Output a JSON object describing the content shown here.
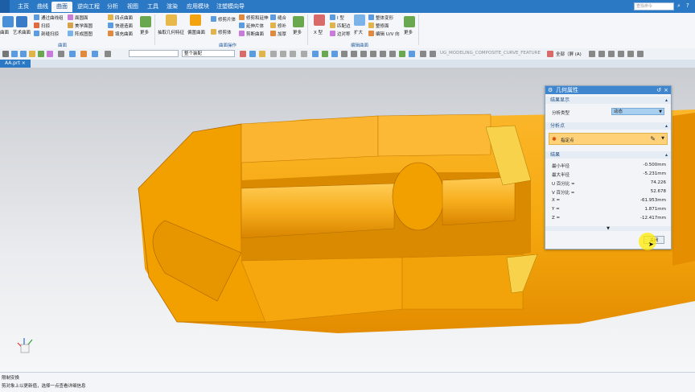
{
  "menubar": {
    "tabs": [
      "主页",
      "曲线",
      "曲面",
      "逆向工程",
      "分析",
      "视图",
      "工具",
      "渲染",
      "应用模块",
      "注塑模向导"
    ],
    "active_tab": "曲面",
    "search_placeholder": "查找命令"
  },
  "ribbon": {
    "col1": [
      "曲面",
      "艺术曲面"
    ],
    "col2": [
      "通过曲线组",
      "扫掠",
      "剖缝扫掠"
    ],
    "col3": [
      "面圆面",
      "美学面圆",
      "阵成图图"
    ],
    "col4": [
      "四点曲面",
      "快速造面",
      "填充曲面"
    ],
    "more1": "更多",
    "col5": [
      "抽取几何特征",
      "偏置曲面"
    ],
    "col6": [
      "修剪片体",
      "修剪体"
    ],
    "col7": [
      "修剪和延伸",
      "延伸片体",
      "剪断曲面"
    ],
    "col8": [
      "缝合",
      "修补",
      "加厚"
    ],
    "more2": "更多",
    "col9": "X 型",
    "col10": [
      "I 型",
      "匹配边",
      "边对称"
    ],
    "col11": "扩大",
    "col12": [
      "整体变形",
      "整修面",
      "编辑 U/V 向"
    ],
    "more3": "更多",
    "groups": [
      "曲面",
      "曲面操作",
      "编辑曲面"
    ]
  },
  "toolbar": {
    "filter_value": "",
    "assembly_value": "整个装配",
    "feature_text": "UG_MODELING_COMPOSITE_CURVE_FEATURE",
    "scope_text": "全部（屏 (A)"
  },
  "doc_tab": "AA.prt",
  "dialog": {
    "title": "几何属性",
    "sec1": "结果显示",
    "analysis_label": "分析类型",
    "analysis_value": "动态",
    "sec2": "分析点",
    "point_label": "指定点",
    "sec3": "结果",
    "results": [
      {
        "label": "最小半径",
        "value": "-0.500mm"
      },
      {
        "label": "最大半径",
        "value": "-5.231mm"
      },
      {
        "label": "U 百分比 =",
        "value": "74.226"
      },
      {
        "label": "V 百分比 =",
        "value": "52.678"
      },
      {
        "label": "X =",
        "value": "-61.953mm"
      },
      {
        "label": "Y =",
        "value": "1.871mm"
      },
      {
        "label": "Z =",
        "value": "-12.417mm"
      }
    ],
    "close_label": "关闭"
  },
  "status": {
    "line1": "限制安换",
    "line2": "剪对象上以更新值，选择一点查看详细信息"
  },
  "colors": {
    "accent": "#2b78c5",
    "part": "#f2a30f",
    "dialog_title": "#3f86cf"
  }
}
